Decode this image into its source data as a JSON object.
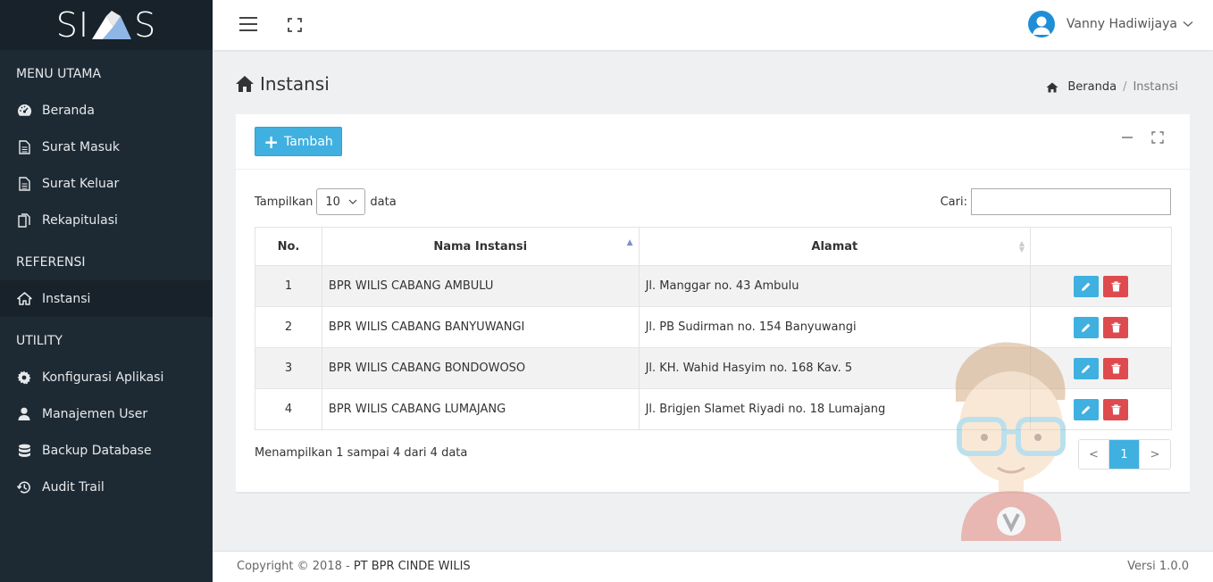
{
  "brand": {
    "logo_text_left": "SI",
    "logo_text_right": "S"
  },
  "sidebar": {
    "sections": [
      {
        "title": "MENU UTAMA"
      },
      {
        "title": "REFERENSI"
      },
      {
        "title": "UTILITY"
      }
    ],
    "items": [
      {
        "label": "Beranda",
        "icon": "dashboard-icon"
      },
      {
        "label": "Surat Masuk",
        "icon": "document-icon"
      },
      {
        "label": "Surat Keluar",
        "icon": "document-icon"
      },
      {
        "label": "Rekapitulasi",
        "icon": "copy-icon"
      },
      {
        "label": "Instansi",
        "icon": "home-icon",
        "active": true
      },
      {
        "label": "Konfigurasi Aplikasi",
        "icon": "gear-icon"
      },
      {
        "label": "Manajemen User",
        "icon": "user-icon"
      },
      {
        "label": "Backup Database",
        "icon": "database-icon"
      },
      {
        "label": "Audit Trail",
        "icon": "history-icon"
      }
    ]
  },
  "topbar": {
    "user_name": "Vanny Hadiwijaya"
  },
  "page": {
    "title": "Instansi"
  },
  "breadcrumb": {
    "home": "Beranda",
    "current": "Instansi"
  },
  "toolbar": {
    "add_label": "Tambah"
  },
  "table_controls": {
    "show_prefix": "Tampilkan",
    "show_value": "10",
    "show_suffix": "data",
    "search_label": "Cari:",
    "search_value": ""
  },
  "table": {
    "columns": [
      "No.",
      "Nama Instansi",
      "Alamat",
      ""
    ],
    "rows": [
      {
        "no": "1",
        "nama": "BPR WILIS CABANG AMBULU",
        "alamat": "Jl. Manggar no. 43 Ambulu"
      },
      {
        "no": "2",
        "nama": "BPR WILIS CABANG BANYUWANGI",
        "alamat": "Jl. PB Sudirman no. 154 Banyuwangi"
      },
      {
        "no": "3",
        "nama": "BPR WILIS CABANG BONDOWOSO",
        "alamat": "Jl. KH. Wahid Hasyim no. 168 Kav. 5"
      },
      {
        "no": "4",
        "nama": "BPR WILIS CABANG LUMAJANG",
        "alamat": "Jl. Brigjen Slamet Riyadi no. 18 Lumajang"
      }
    ]
  },
  "pagination": {
    "info": "Menampilkan 1 sampai 4 dari 4 data",
    "prev": "<",
    "current": "1",
    "next": ">"
  },
  "footer": {
    "copyright_prefix": "Copyright © 2018 - ",
    "company": "PT BPR CINDE WILIS",
    "version": "Versi 1.0.0"
  },
  "colors": {
    "sidebar_bg": "#1e2a33",
    "accent": "#3fb0e0",
    "danger": "#dd4b4f"
  }
}
